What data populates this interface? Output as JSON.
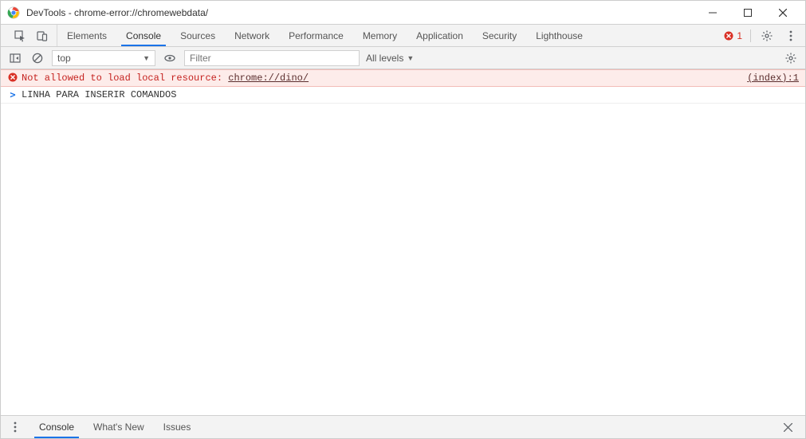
{
  "title": "DevTools - chrome-error://chromewebdata/",
  "tabs": [
    "Elements",
    "Console",
    "Sources",
    "Network",
    "Performance",
    "Memory",
    "Application",
    "Security",
    "Lighthouse"
  ],
  "activeTabIndex": 1,
  "errorCount": "1",
  "context": {
    "value": "top"
  },
  "filter": {
    "placeholder": "Filter",
    "value": ""
  },
  "levels": {
    "label": "All levels"
  },
  "log": {
    "error": {
      "text": "Not allowed to load local resource: ",
      "link": "chrome://dino/",
      "source": "(index):1"
    },
    "input": {
      "text": "LINHA PARA INSERIR COMANDOS"
    }
  },
  "drawerTabs": [
    "Console",
    "What's New",
    "Issues"
  ],
  "drawerActiveIndex": 0
}
